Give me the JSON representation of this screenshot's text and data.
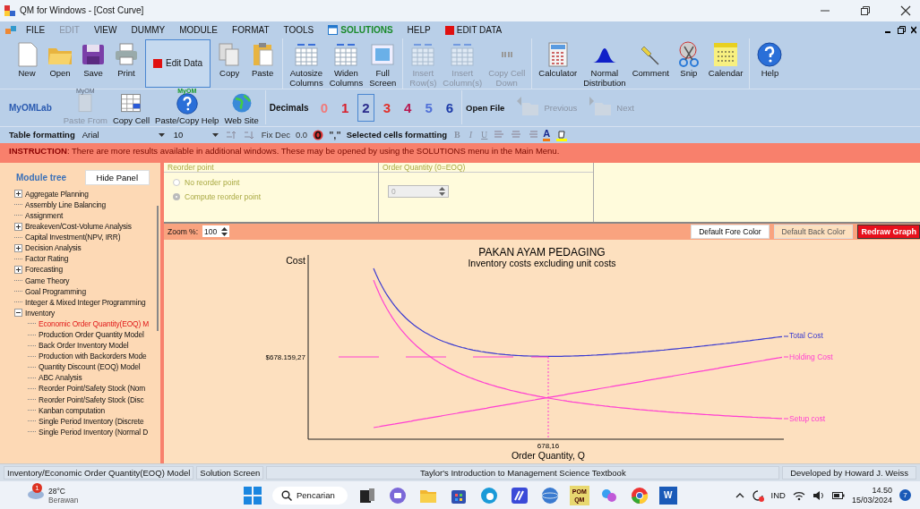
{
  "window": {
    "title": "QM for Windows - [Cost Curve]"
  },
  "menu": [
    {
      "label": "FILE",
      "kind": "plain",
      "disabled": false
    },
    {
      "label": "EDIT",
      "kind": "plain",
      "disabled": true
    },
    {
      "label": "VIEW",
      "kind": "plain",
      "disabled": false
    },
    {
      "label": "DUMMY",
      "kind": "plain",
      "disabled": false
    },
    {
      "label": "MODULE",
      "kind": "plain",
      "disabled": false
    },
    {
      "label": "FORMAT",
      "kind": "plain",
      "disabled": false
    },
    {
      "label": "TOOLS",
      "kind": "plain",
      "disabled": false
    },
    {
      "label": "SOLUTIONS",
      "kind": "solutions",
      "disabled": false
    },
    {
      "label": "HELP",
      "kind": "plain",
      "disabled": false
    },
    {
      "label": "EDIT DATA",
      "kind": "data",
      "disabled": false
    }
  ],
  "toolbar": [
    [
      {
        "label": "New",
        "kind": "new",
        "disabled": false
      },
      {
        "label": "Open",
        "kind": "open",
        "disabled": false
      },
      {
        "label": "Save",
        "kind": "save",
        "disabled": false
      },
      {
        "label": "Print",
        "kind": "print",
        "disabled": false
      },
      {
        "label": "Edit Data",
        "kind": "toggle",
        "on": true,
        "disabled": false
      },
      {
        "label": "Copy",
        "kind": "copy",
        "disabled": false
      },
      {
        "label": "Paste",
        "kind": "paste",
        "disabled": false
      }
    ],
    [
      {
        "label": "Autosize\nColumns",
        "kind": "grid",
        "disabled": false
      },
      {
        "label": "Widen\nColumns",
        "kind": "grid",
        "disabled": false
      },
      {
        "label": "Full\nScreen",
        "kind": "screen",
        "disabled": false
      }
    ],
    [
      {
        "label": "Insert\nRow(s)",
        "kind": "grid",
        "disabled": true
      },
      {
        "label": "Insert\nColumn(s)",
        "kind": "grid",
        "disabled": true
      },
      {
        "label": "Copy Cell\nDown",
        "kind": "quote",
        "disabled": true
      }
    ],
    [
      {
        "label": "Calculator",
        "kind": "calc",
        "disabled": false
      },
      {
        "label": "Normal\nDistribution",
        "kind": "bell",
        "disabled": false
      },
      {
        "label": "Comment",
        "kind": "pin",
        "disabled": false
      },
      {
        "label": "Snip",
        "kind": "snip",
        "disabled": false
      },
      {
        "label": "Calendar",
        "kind": "calendar",
        "disabled": false
      }
    ],
    [
      {
        "label": "Help",
        "kind": "help",
        "disabled": false
      }
    ]
  ],
  "toolbar2": {
    "brand": "MyOMLab",
    "tools": [
      {
        "label": "Paste From",
        "caption": "MyOM",
        "kind": "sheet",
        "disabled": true
      },
      {
        "label": "Copy Cell",
        "kind": "cell",
        "disabled": false
      },
      {
        "label": "Paste/Copy Help",
        "caption": "MyOM",
        "kind": "help",
        "disabled": false
      },
      {
        "label": "Web Site",
        "kind": "globe",
        "disabled": false
      }
    ],
    "decimals_label": "Decimals",
    "decimals": [
      {
        "label": "0",
        "color": "#f07a7a",
        "selected": false
      },
      {
        "label": "1",
        "color": "#d8202c",
        "selected": false
      },
      {
        "label": "2",
        "color": "#2b2b8c",
        "selected": true
      },
      {
        "label": "3",
        "color": "#e2302a",
        "selected": false
      },
      {
        "label": "4",
        "color": "#b81850",
        "selected": false
      },
      {
        "label": "5",
        "color": "#5070d8",
        "selected": false
      },
      {
        "label": "6",
        "color": "#1c3aa8",
        "selected": false
      }
    ],
    "files": [
      {
        "label": "Open File",
        "kind": "text",
        "disabled": false
      },
      {
        "label": "Previous",
        "kind": "prev",
        "disabled": true
      },
      {
        "label": "Next",
        "kind": "next",
        "disabled": true
      }
    ]
  },
  "format_bar": {
    "table_label": "Table formatting",
    "font": "Arial",
    "size": "10",
    "fix_dec": "Fix Dec",
    "zero_format": "0.0",
    "comma_format": "\",\"",
    "selected_label": "Selected cells formatting",
    "styles": [
      {
        "label": "B",
        "kind": "bold"
      },
      {
        "label": "I",
        "kind": "italic"
      },
      {
        "label": "U",
        "kind": "underline"
      }
    ],
    "font_color": "A"
  },
  "instruction": "**INSTRUCTION**:  There are more results available in additional windows. These may be opened by using the SOLUTIONS menu in the Main Menu.",
  "module_tree": {
    "title": "Module tree",
    "hide_button": "Hide Panel",
    "items": [
      {
        "label": "Aggregate Planning",
        "kind": "group",
        "expanded": false,
        "selected": false
      },
      {
        "label": "Assembly Line Balancing",
        "kind": "leaf",
        "selected": false
      },
      {
        "label": "Assignment",
        "kind": "leaf",
        "selected": false
      },
      {
        "label": "Breakeven/Cost-Volume Analysis",
        "kind": "group",
        "expanded": false,
        "selected": false
      },
      {
        "label": "Capital Investment(NPV, IRR)",
        "kind": "leaf",
        "selected": false
      },
      {
        "label": "Decision Analysis",
        "kind": "group",
        "expanded": false,
        "selected": false
      },
      {
        "label": "Factor Rating",
        "kind": "leaf",
        "selected": false
      },
      {
        "label": "Forecasting",
        "kind": "group",
        "expanded": false,
        "selected": false
      },
      {
        "label": "Game Theory",
        "kind": "leaf",
        "selected": false
      },
      {
        "label": "Goal Programming",
        "kind": "leaf",
        "selected": false
      },
      {
        "label": "Integer & Mixed Integer Programming",
        "kind": "leaf",
        "selected": false
      },
      {
        "label": "Inventory",
        "kind": "group",
        "expanded": true,
        "selected": false,
        "children": [
          {
            "label": "Economic Order Quantity(EOQ) M",
            "kind": "leaf",
            "selected": true
          },
          {
            "label": "Production Order Quantity Model",
            "kind": "leaf",
            "selected": false
          },
          {
            "label": "Back Order Inventory Model",
            "kind": "leaf",
            "selected": false
          },
          {
            "label": "Production with Backorders Mode",
            "kind": "leaf",
            "selected": false
          },
          {
            "label": "Quantity Discount (EOQ) Model",
            "kind": "leaf",
            "selected": false
          },
          {
            "label": "ABC Analysis",
            "kind": "leaf",
            "selected": false
          },
          {
            "label": "Reorder Point/Safety Stock (Nom",
            "kind": "leaf",
            "selected": false
          },
          {
            "label": "Reorder Point/Safety Stock (Disc",
            "kind": "leaf",
            "selected": false
          },
          {
            "label": "Kanban computation",
            "kind": "leaf",
            "selected": false
          },
          {
            "label": "Single Period Inventory (Discrete",
            "kind": "leaf",
            "selected": false
          },
          {
            "label": "Single Period Inventory (Normal D",
            "kind": "leaf",
            "selected": false
          }
        ]
      }
    ]
  },
  "reorder_point": {
    "legend": "Reorder point",
    "options": [
      {
        "label": "No reorder point",
        "selected": false
      },
      {
        "label": "Compute reorder point",
        "selected": true
      }
    ]
  },
  "order_quantity": {
    "legend": "Order Quantity (0=EOQ)",
    "value": "0"
  },
  "graph_toolbar": {
    "zoom_label": "Zoom %:",
    "zoom": "100",
    "buttons": [
      {
        "label": "Default Fore Color",
        "kind": "fore"
      },
      {
        "label": "Default Back Color",
        "kind": "back"
      },
      {
        "label": "Redraw Graph",
        "kind": "redraw"
      }
    ]
  },
  "chart": {
    "title": "PAKAN AYAM PEDAGING",
    "subtitle": "Inventory costs excluding unit costs",
    "ylabel": "Cost",
    "xlabel": "Order Quantity, Q",
    "y_marker": "$678.159,27",
    "x_marker": "678,16",
    "series": [
      {
        "name": "Total Cost",
        "color": "#3a3ad0"
      },
      {
        "name": "Holding Cost",
        "color": "#ff3fd2"
      },
      {
        "name": "Setup cost",
        "color": "#ff3fd2"
      }
    ]
  },
  "status_bar": [
    "Inventory/Economic Order Quantity(EOQ) Model",
    "Solution Screen",
    "Taylor's Introduction to Management Science Textbook",
    "Developed by Howard J. Weiss"
  ],
  "taskbar": {
    "weather": {
      "badge": "1",
      "temp": "28°C",
      "condition": "Berawan"
    },
    "search": "Pencarian",
    "apps": [
      {
        "kind": "start"
      },
      {
        "kind": "search"
      },
      {
        "kind": "taskview"
      },
      {
        "kind": "chat"
      },
      {
        "kind": "files"
      },
      {
        "kind": "store"
      },
      {
        "kind": "edge"
      },
      {
        "kind": "app"
      },
      {
        "kind": "globe"
      },
      {
        "kind": "pomqm",
        "label": "POM QM"
      },
      {
        "kind": "copilot"
      },
      {
        "kind": "chrome"
      },
      {
        "kind": "word",
        "label": "W"
      }
    ],
    "language": "IND",
    "time": "14.50",
    "date": "15/03/2024",
    "notifications": "7"
  }
}
